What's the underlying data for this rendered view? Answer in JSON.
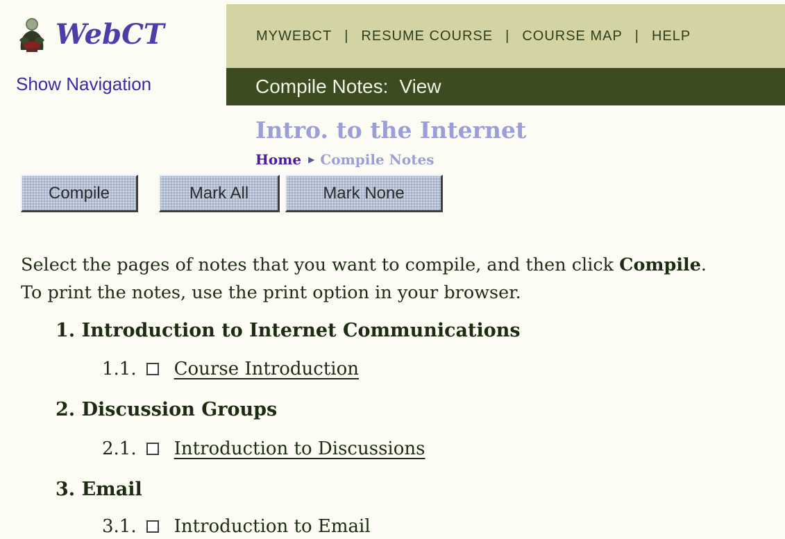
{
  "logo": {
    "text": "WebCT",
    "icon": "webct-figure-icon"
  },
  "nav_toggle": {
    "label": "Show Navigation"
  },
  "top_nav": {
    "items": [
      "MYWEBCT",
      "RESUME COURSE",
      "COURSE MAP",
      "HELP"
    ],
    "separator": "|"
  },
  "title_bar": {
    "tool": "Compile Notes:",
    "mode": "View"
  },
  "course": {
    "title": "Intro. to the Internet"
  },
  "breadcrumb": {
    "home": "Home",
    "current": "Compile Notes"
  },
  "buttons": {
    "compile": "Compile",
    "mark_all": "Mark All",
    "mark_none": "Mark None"
  },
  "instructions": {
    "line1_prefix": "Select the pages of notes that you want to compile, and then click ",
    "line1_bold": "Compile",
    "line1_suffix": ".",
    "line2": "To print the notes, use the print option in your browser."
  },
  "sections": [
    {
      "heading": "1. Introduction to Internet Communications",
      "items": [
        {
          "number": "1.1.",
          "title": "Course Introduction",
          "checked": false,
          "linked": true
        }
      ]
    },
    {
      "heading": "2. Discussion Groups",
      "items": [
        {
          "number": "2.1.",
          "title": "Introduction to Discussions",
          "checked": false,
          "linked": true
        }
      ]
    },
    {
      "heading": "3. Email",
      "items": [
        {
          "number": "3.1.",
          "title": "Introduction to Email",
          "checked": false,
          "linked": false
        }
      ]
    }
  ],
  "colors": {
    "background": "#fcfcf4",
    "top_nav_bg": "#d3d3a3",
    "title_bar_bg": "#3d4c20",
    "course_title": "#9c9ed6",
    "home_link": "#4b1ca0",
    "logo_text": "#4d3da6",
    "button_bg": "#b7c2d6"
  }
}
